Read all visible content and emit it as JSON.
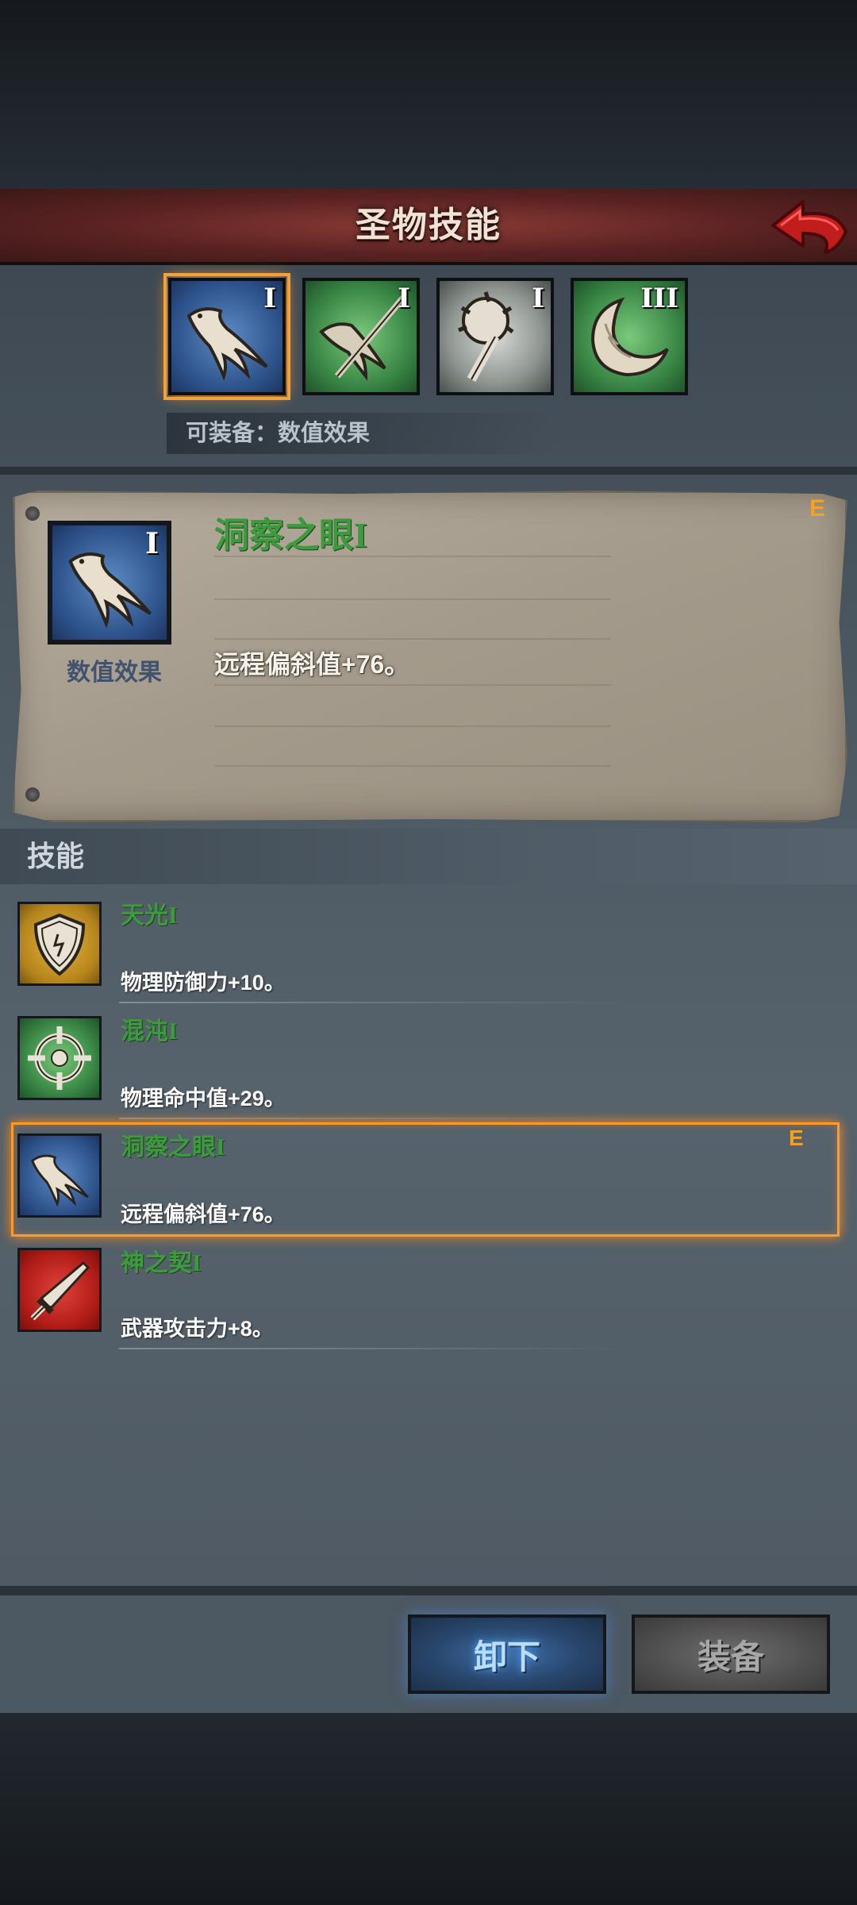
{
  "header": {
    "title": "圣物技能"
  },
  "relic_tabs": [
    {
      "icon": "feather-claw-icon",
      "level": "I",
      "color": "blue",
      "selected": true
    },
    {
      "icon": "feather-arrow-icon",
      "level": "I",
      "color": "green",
      "selected": false
    },
    {
      "icon": "spiked-mace-icon",
      "level": "I",
      "color": "grey",
      "selected": false
    },
    {
      "icon": "crescent-horn-icon",
      "level": "III",
      "color": "green",
      "selected": false
    }
  ],
  "equip_hint": "可装备：数值效果",
  "detail": {
    "icon": "feather-claw-icon",
    "level": "I",
    "type": "数值效果",
    "name": "洞察之眼I",
    "effect": "远程偏斜值+76。",
    "equipped_mark": "E"
  },
  "skills": {
    "title": "技能",
    "items": [
      {
        "icon": "shield-icon",
        "name": "天光I",
        "effect": "物理防御力+10。",
        "equipped": false
      },
      {
        "icon": "crosshair-icon",
        "name": "混沌I",
        "effect": "物理命中值+29。",
        "equipped": false
      },
      {
        "icon": "feather-claw-icon",
        "name": "洞察之眼I",
        "effect": "远程偏斜值+76。",
        "equipped": true,
        "mark": "E"
      },
      {
        "icon": "sword-icon",
        "name": "神之契I",
        "effect": "武器攻击力+8。",
        "equipped": false
      }
    ]
  },
  "buttons": {
    "unequip": "卸下",
    "equip": "装备"
  },
  "colors": {
    "skill_name": "#3c9b3c",
    "highlight": "#ff9a2a",
    "equip_mark": "#f1a128"
  }
}
